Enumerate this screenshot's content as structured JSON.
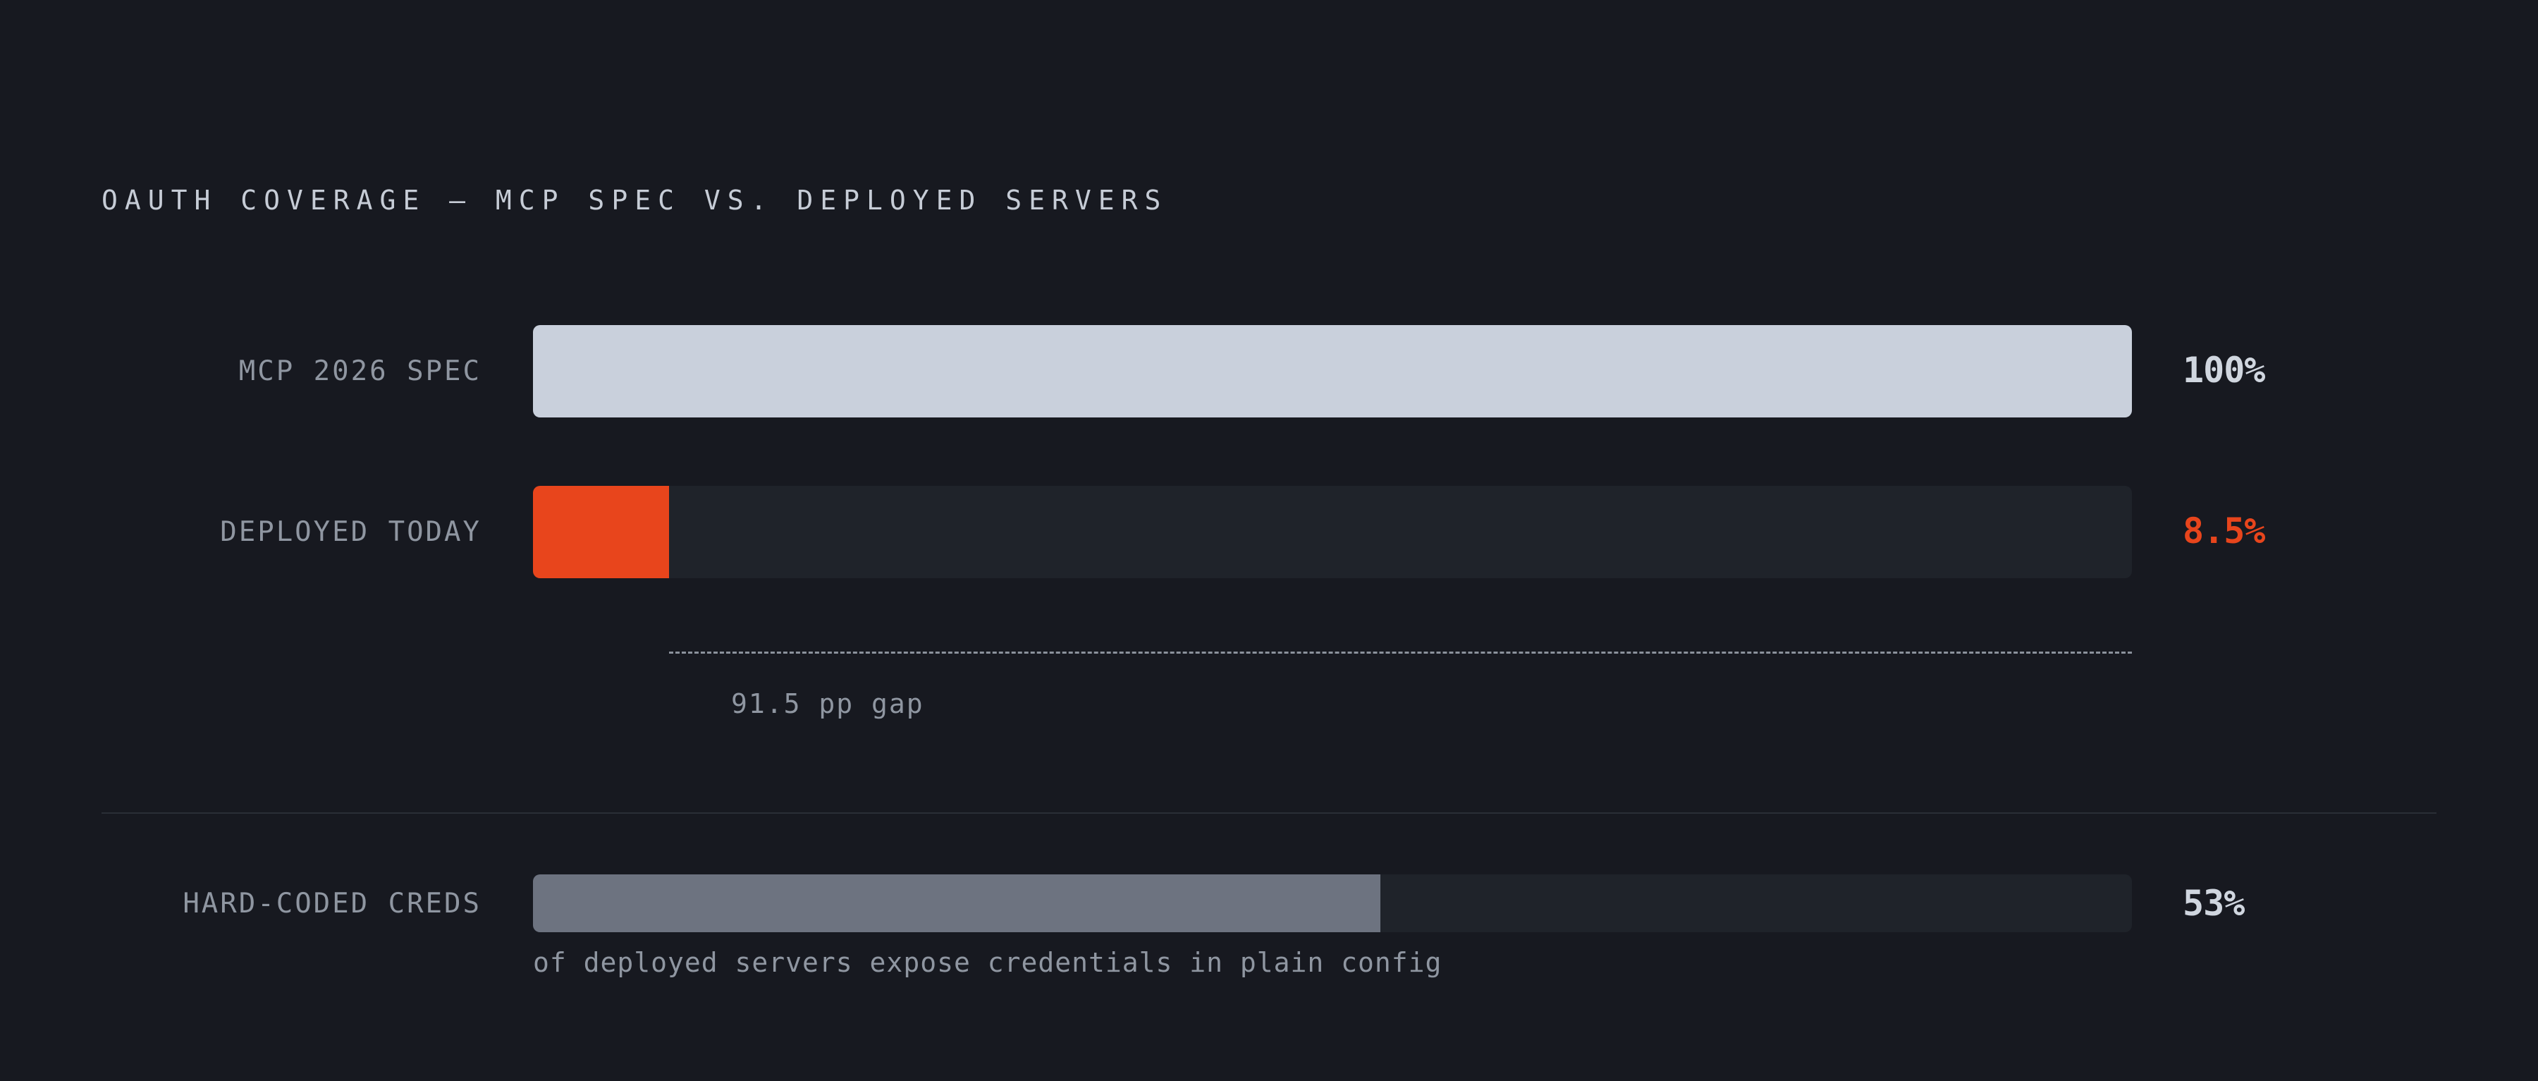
{
  "chart_data": {
    "type": "bar",
    "orientation": "horizontal",
    "title": "OAUTH COVERAGE — MCP SPEC VS. DEPLOYED SERVERS",
    "xlim": [
      0,
      100
    ],
    "unit": "%",
    "rows": [
      {
        "label": "MCP 2026 SPEC",
        "value": 100,
        "value_label": "100%",
        "color": "#c9d0dc",
        "value_color": "#d0d6df"
      },
      {
        "label": "DEPLOYED TODAY",
        "value": 8.5,
        "value_label": "8.5%",
        "color": "#e8451c",
        "value_color": "#e8451c"
      }
    ],
    "gap_annotation": {
      "from": 8.5,
      "to": 100,
      "label": "91.5 pp gap"
    },
    "secondary": {
      "label": "HARD-CODED CREDS",
      "value": 53,
      "value_label": "53%",
      "color": "#6d7380",
      "value_color": "#d0d6df",
      "note": "of deployed servers expose credentials in plain config"
    },
    "track_color": "#1f232a"
  }
}
